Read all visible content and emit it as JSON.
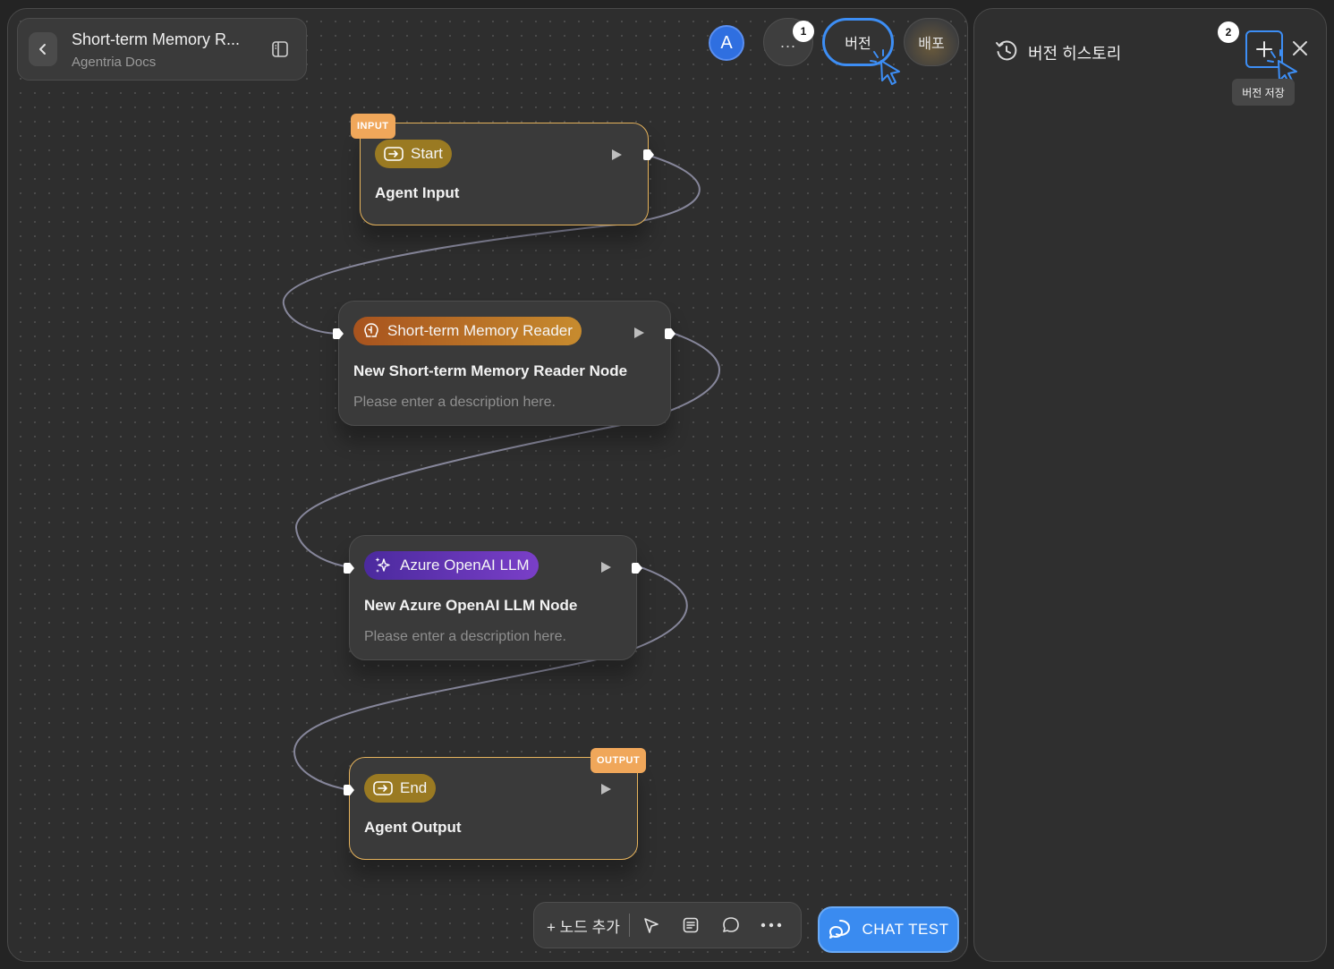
{
  "header": {
    "title": "Short-term Memory R...",
    "subtitle": "Agentria Docs"
  },
  "topbar": {
    "avatar_letter": "A",
    "more_label": "...",
    "version_label": "버전",
    "deploy_label": "배포",
    "step1": "1",
    "step2": "2"
  },
  "nodes": [
    {
      "io_label": "INPUT",
      "tag": "Start",
      "title": "Agent Input",
      "desc": ""
    },
    {
      "io_label": "",
      "tag": "Short-term Memory Reader",
      "title": "New Short-term Memory Reader Node",
      "desc": "Please enter a description here."
    },
    {
      "io_label": "",
      "tag": "Azure OpenAI LLM",
      "title": "New Azure OpenAI LLM Node",
      "desc": "Please enter a description here."
    },
    {
      "io_label": "OUTPUT",
      "tag": "End",
      "title": "Agent Output",
      "desc": ""
    }
  ],
  "toolbar": {
    "add_node_label": "+ 노드 추가",
    "chat_test_label": "CHAT TEST"
  },
  "panel": {
    "title": "버전 히스토리",
    "tooltip": "버전 저장"
  },
  "colors": {
    "accent": "#3d8ef5",
    "io_border": "#e6b35c",
    "io_label": "#f0a75a",
    "start_tag": "#9a7a22",
    "memory_tag": "#c78b2e",
    "llm_tag": "#7a3fc8"
  }
}
